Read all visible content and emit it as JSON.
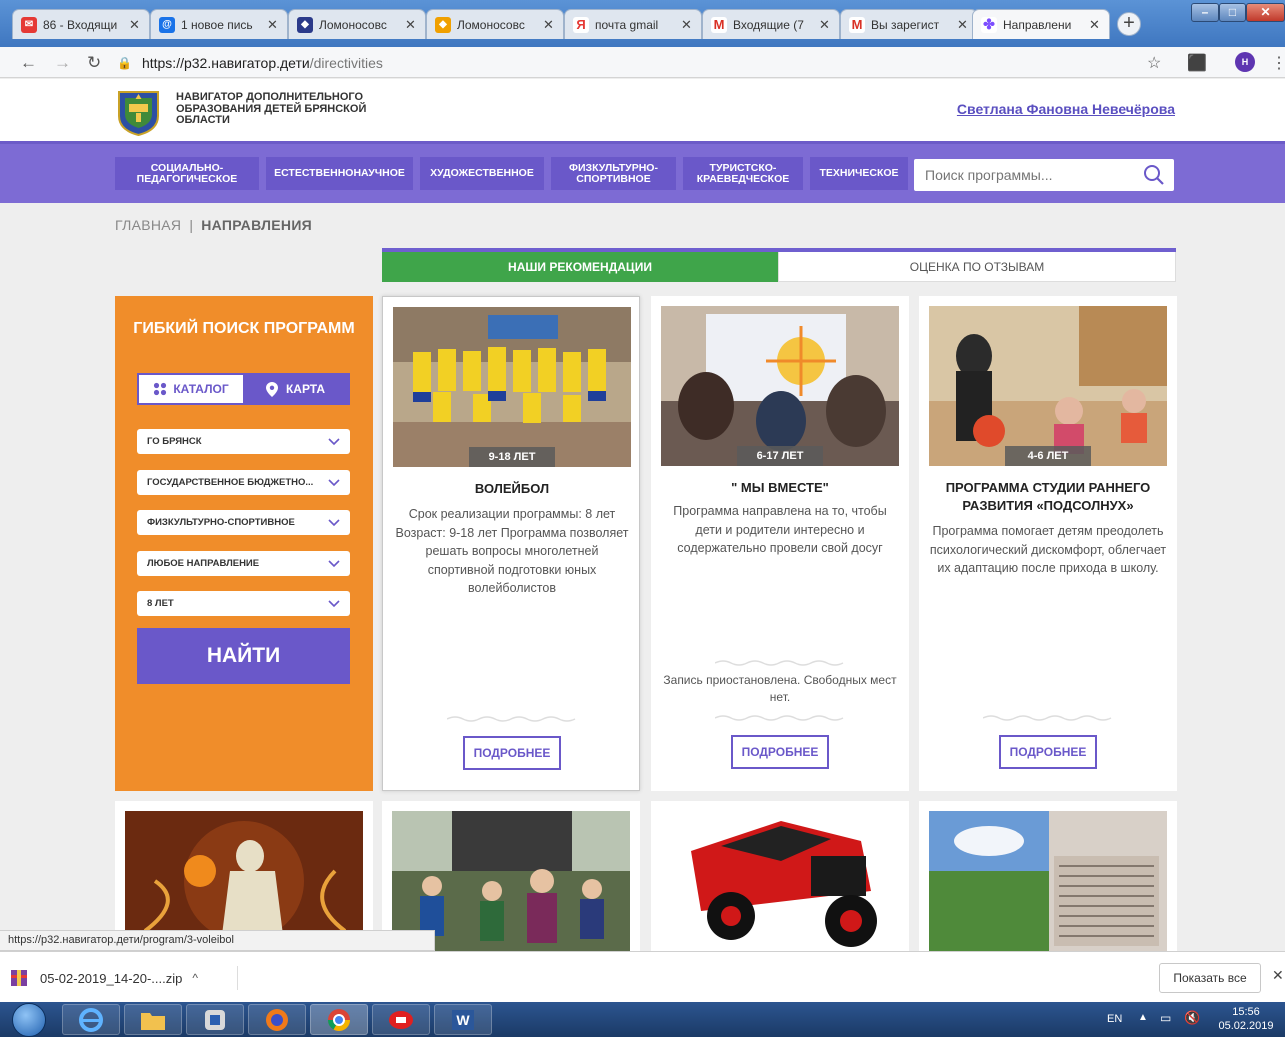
{
  "browser": {
    "tabs": [
      {
        "title": "86 - Входящи",
        "favicon_color": "#e53935",
        "favicon": "envelope-icon"
      },
      {
        "title": "1 новое пись",
        "favicon_color": "#1a73e8",
        "favicon": "at-icon"
      },
      {
        "title": "Ломоносовс",
        "favicon_color": "#2b3a8a",
        "favicon": "crest-icon"
      },
      {
        "title": "Ломоносовс",
        "favicon_color": "#f0a000",
        "favicon": "crest-icon"
      },
      {
        "title": "почта gmail",
        "favicon_color": "#e53935",
        "favicon": "yandex-icon"
      },
      {
        "title": "Входящие (7",
        "favicon_color": "#d93025",
        "favicon": "gmail-icon"
      },
      {
        "title": "Вы зарегист",
        "favicon_color": "#d93025",
        "favicon": "gmail-icon"
      },
      {
        "title": "Направлени",
        "favicon_color": "#7c4dff",
        "favicon": "flower-icon"
      }
    ],
    "url_host": "https://p32.навигатор.дети",
    "url_path": "/directivities",
    "profile_initial": "Н"
  },
  "site": {
    "name": "НАВИГАТОР ДОПОЛНИТЕЛЬНОГО ОБРАЗОВАНИЯ ДЕТЕЙ БРЯНСКОЙ ОБЛАСТИ",
    "user": "Светлана Фановна Невечёрова",
    "menu": [
      "СОЦИАЛЬНО-ПЕДАГОГИЧЕСКОЕ",
      "ЕСТЕСТВЕННОНАУЧНОЕ",
      "ХУДОЖЕСТВЕННОЕ",
      "ФИЗКУЛЬТУРНО-СПОРТИВНОЕ",
      "ТУРИСТСКО-КРАЕВЕДЧЕСКОЕ",
      "ТЕХНИЧЕСКОЕ"
    ],
    "search_placeholder": "Поиск программы...",
    "breadcrumb": {
      "home": "ГЛАВНАЯ",
      "sep": "|",
      "current": "НАПРАВЛЕНИЯ"
    },
    "rec_tabs": {
      "ours": "НАШИ РЕКОМЕНДАЦИИ",
      "reviews": "ОЦЕНКА ПО ОТЗЫВАМ"
    }
  },
  "filter": {
    "title": "ГИБКИЙ ПОИСК ПРОГРАММ",
    "catalog": "КАТАЛОГ",
    "map": "КАРТА",
    "selects": [
      "ГО БРЯНСК",
      "ГОСУДАРСТВЕННОЕ БЮДЖЕТНО...",
      "ФИЗКУЛЬТУРНО-СПОРТИВНОЕ",
      "ЛЮБОЕ НАПРАВЛЕНИЕ",
      "8 ЛЕТ"
    ],
    "find": "НАЙТИ"
  },
  "cards": [
    {
      "age": "9-18 ЛЕТ",
      "title": "ВОЛЕЙБОЛ",
      "description": "Срок реализации программы: 8 лет Возраст: 9-18 лет Программа позволяет решать вопросы многолетней спортивной подготовки юных волейболистов",
      "status": "",
      "more": "ПОДРОБНЕЕ"
    },
    {
      "age": "6-17 ЛЕТ",
      "title": "\" МЫ ВМЕСТЕ\"",
      "description": "Программа направлена на то, чтобы дети и родители интересно и содержательно провели свой досуг",
      "status": "Запись приостановлена. Свободных мест нет.",
      "more": "ПОДРОБНЕЕ"
    },
    {
      "age": "4-6 ЛЕТ",
      "title": "ПРОГРАММА СТУДИИ РАННЕГО РАЗВИТИЯ «ПОДСОЛНУХ»",
      "description": "Программа помогает детям преодолеть психологический дискомфорт, облегчает их адаптацию после прихода в школу.",
      "status": "",
      "more": "ПОДРОБНЕЕ"
    }
  ],
  "status_url": "https://p32.навигатор.дети/program/3-voleibol",
  "downloads": {
    "file": "05-02-2019_14-20-....zip",
    "show_all": "Показать все"
  },
  "taskbar": {
    "lang": "EN",
    "time": "15:56",
    "date": "05.02.2019"
  },
  "colors": {
    "accent": "#6a58c9",
    "orange": "#f08d2a",
    "green": "#3fa54a"
  }
}
